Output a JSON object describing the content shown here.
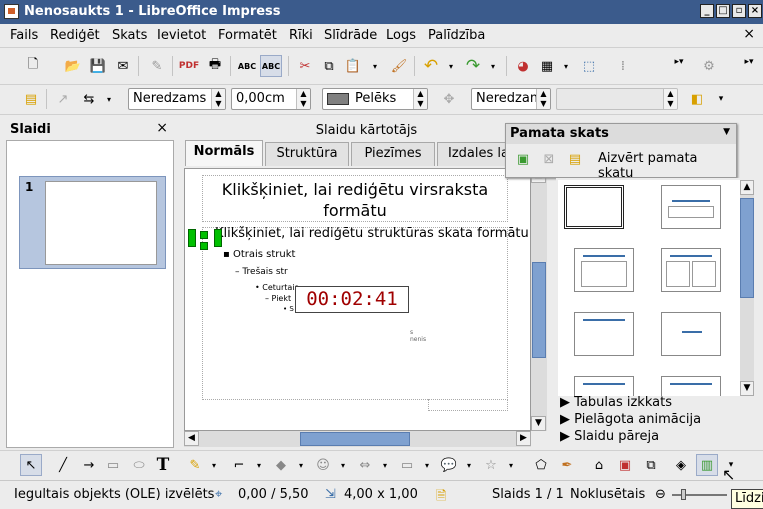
{
  "window": {
    "title": "Nenosaukts 1 - LibreOffice Impress"
  },
  "menu": [
    "Fails",
    "Rediģēt",
    "Skats",
    "Ievietot",
    "Formatēt",
    "Rīki",
    "Slīdrāde",
    "Logs",
    "Palīdzība"
  ],
  "line_toolbar": {
    "line_style": "Neredzams",
    "line_width": "0,00cm",
    "area_color": "Pelēks",
    "area_style": "Neredzams",
    "area_fill": ""
  },
  "slides_pane": {
    "title": "Slaidi",
    "slide_number": "1"
  },
  "sorter": {
    "label": "Slaidu kārtotājs"
  },
  "tabs": [
    "Normāls",
    "Struktūra",
    "Piezīmes",
    "Izdales la"
  ],
  "slide": {
    "title_placeholder": "Klikšķiniet, lai rediģētu virsraksta formātu",
    "outline_1": "Klikšķiniet, lai rediģētu struktūras skata formātu",
    "outline_2": "Otrais strukt",
    "outline_3": "Trešais str",
    "outline_4": "Ceturtais",
    "outline_5": "Piekt",
    "outline_6": "S",
    "timer": "00:02:41",
    "timer_color": "#a00000"
  },
  "master_view": {
    "title": "Pamata skats",
    "close_label": "Aizvērt pamata skatu"
  },
  "task_pane": {
    "expanders": [
      "Tabulas izkkats",
      "Pielāgota animācija",
      "Slaidu pāreja"
    ]
  },
  "status": {
    "selection": "Iegultais objekts (OLE) izvēlēts",
    "position": "0,00 / 5,50",
    "size": "4,00 x 1,00",
    "slide": "Slaids 1 / 1",
    "layout": "Noklusētais"
  },
  "tooltip": "Līdzi",
  "colors": {
    "titlebar": "#3b5b8c",
    "accent": "#3a6ea8",
    "selection_handle": "#00c000"
  }
}
